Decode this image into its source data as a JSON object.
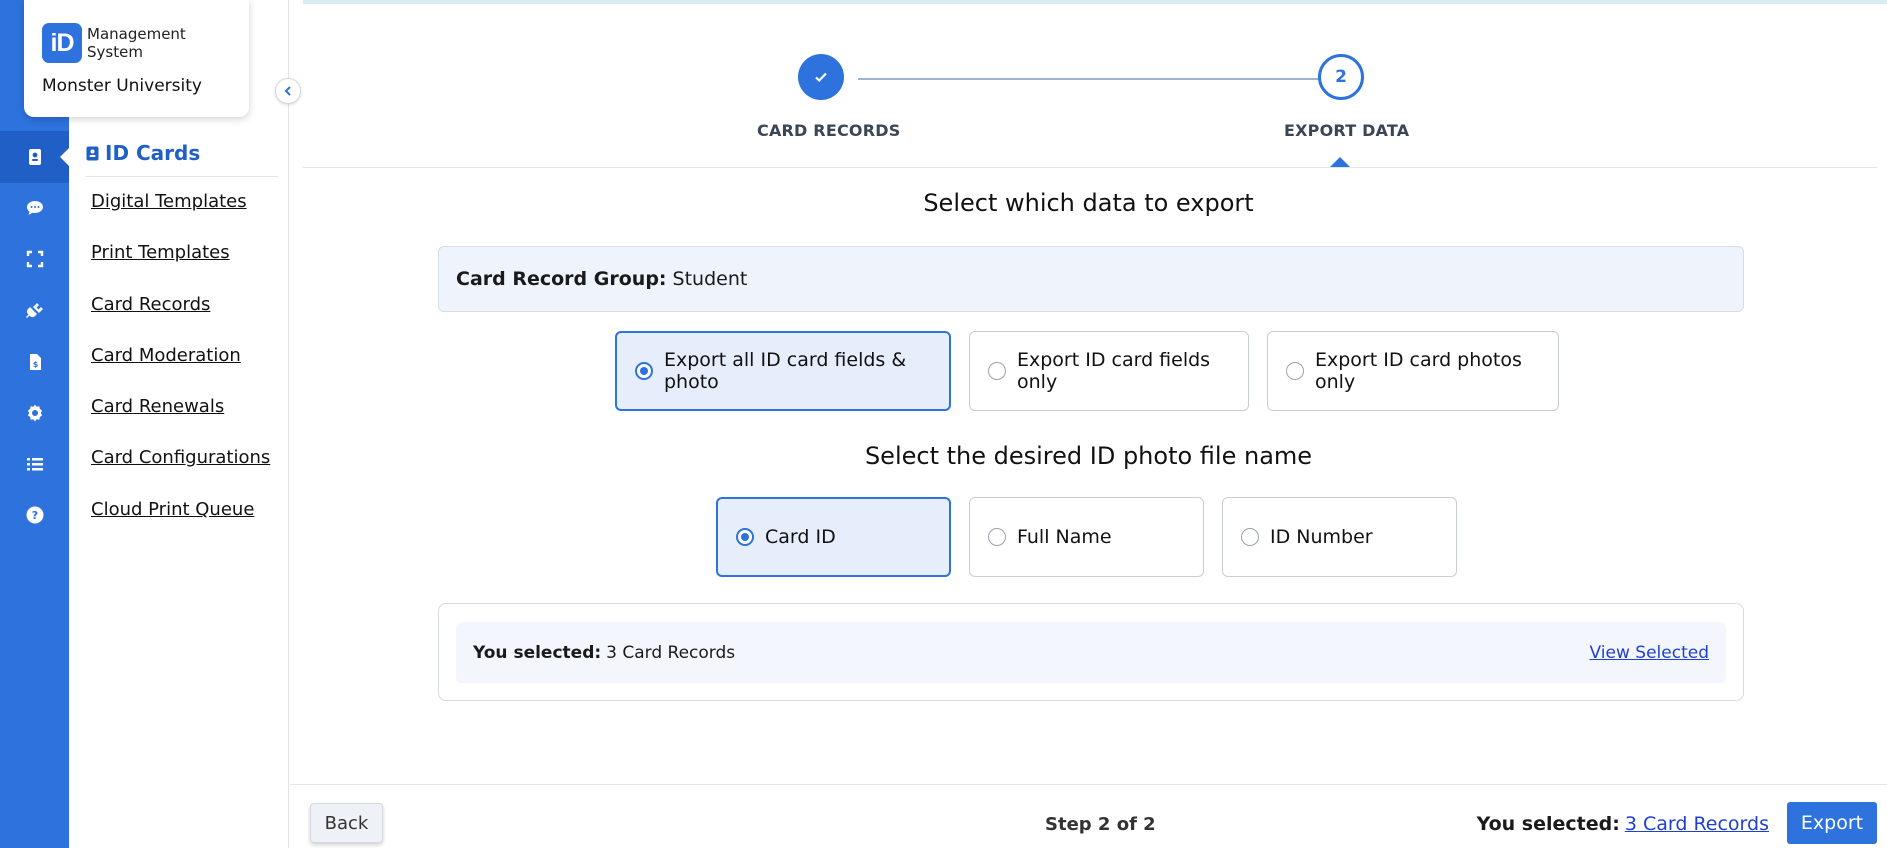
{
  "brand": {
    "logo_mark": "iD",
    "product_line1": "Management",
    "product_line2": "System",
    "organization": "Monster University",
    "accent_color": "#2d72dd"
  },
  "rail": {
    "items": [
      {
        "icon": "id-card-icon",
        "active": true
      },
      {
        "icon": "chat-icon",
        "active": false
      },
      {
        "icon": "scan-frame-icon",
        "active": false
      },
      {
        "icon": "plug-icon",
        "active": false
      },
      {
        "icon": "invoice-icon",
        "active": false
      },
      {
        "icon": "gear-icon",
        "active": false
      },
      {
        "icon": "list-icon",
        "active": false
      },
      {
        "icon": "help-icon",
        "active": false
      }
    ]
  },
  "subnav": {
    "title": "ID Cards",
    "items": [
      {
        "label": "Digital Templates"
      },
      {
        "label": "Print Templates"
      },
      {
        "label": "Card Records"
      },
      {
        "label": "Card Moderation"
      },
      {
        "label": "Card Renewals"
      },
      {
        "label": "Card Configurations"
      },
      {
        "label": "Cloud Print Queue"
      }
    ]
  },
  "stepper": {
    "steps": [
      {
        "label": "CARD RECORDS",
        "status": "done"
      },
      {
        "label": "EXPORT DATA",
        "number": "2",
        "status": "current"
      }
    ]
  },
  "export": {
    "title": "Select which data to export",
    "group_label": "Card Record Group:",
    "group_value": "Student",
    "options": [
      {
        "label": "Export all ID card fields & photo",
        "selected": true
      },
      {
        "label": "Export ID card fields only",
        "selected": false
      },
      {
        "label": "Export ID card photos only",
        "selected": false
      }
    ]
  },
  "filename": {
    "title": "Select the desired ID photo file name",
    "options": [
      {
        "label": "Card ID",
        "selected": true
      },
      {
        "label": "Full Name",
        "selected": false
      },
      {
        "label": "ID Number",
        "selected": false
      }
    ]
  },
  "summary": {
    "label": "You selected:",
    "value": "3 Card Records",
    "view_link": "View Selected"
  },
  "footer": {
    "back_label": "Back",
    "step_text": "Step 2 of 2",
    "selected_label": "You selected:",
    "selected_link": "3 Card Records",
    "export_label": "Export"
  }
}
